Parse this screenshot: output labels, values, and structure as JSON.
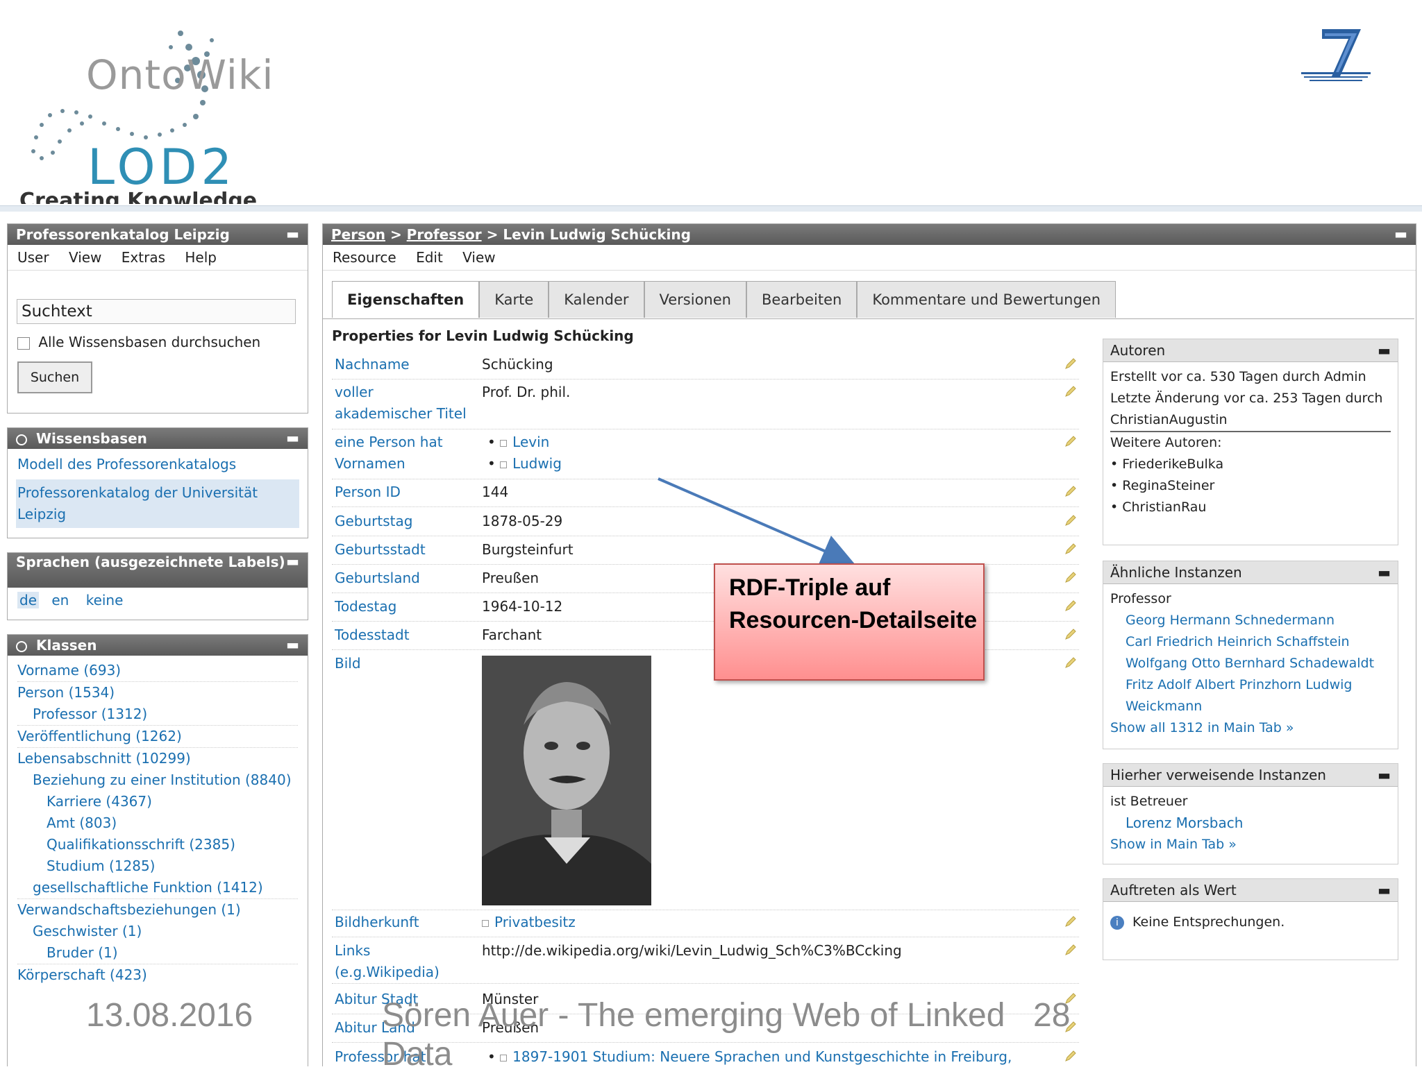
{
  "slide": {
    "logo_ontowiki": "OntoWiki",
    "logo_lod2": "LOD2",
    "tagline": "Creating Knowledge",
    "date": "13.08.2016",
    "title": "Sören Auer - The emerging Web of Linked Data",
    "page": "28"
  },
  "left": {
    "app_box": {
      "title": "Professorenkatalog Leipzig",
      "menu": [
        "User",
        "View",
        "Extras",
        "Help"
      ],
      "search_value": "Suchtext",
      "checkbox_label": "Alle Wissensbasen durchsuchen",
      "search_button": "Suchen"
    },
    "wissensbasen": {
      "title": "Wissensbasen",
      "items": [
        "Modell des Professorenkatalogs",
        "Professorenkatalog der Universität Leipzig"
      ]
    },
    "sprachen": {
      "title": "Sprachen (ausgezeichnete Labels)",
      "items": [
        "de",
        "en",
        "keine"
      ]
    },
    "klassen": {
      "title": "Klassen",
      "items": [
        {
          "label": "Vorname (693)",
          "level": 0
        },
        {
          "label": "Person (1534)",
          "level": 0
        },
        {
          "label": "Professor (1312)",
          "level": 1
        },
        {
          "label": "Veröffentlichung (1262)",
          "level": 0
        },
        {
          "label": "Lebensabschnitt (10299)",
          "level": 0
        },
        {
          "label": "Beziehung zu einer Institution (8840)",
          "level": 1
        },
        {
          "label": "Karriere (4367)",
          "level": 2
        },
        {
          "label": "Amt (803)",
          "level": 2
        },
        {
          "label": "Qualifikationsschrift (2385)",
          "level": 2
        },
        {
          "label": "Studium (1285)",
          "level": 2
        },
        {
          "label": "gesellschaftliche Funktion (1412)",
          "level": 1
        },
        {
          "label": "Verwandschaftsbeziehungen (1)",
          "level": 0
        },
        {
          "label": "Geschwister (1)",
          "level": 1
        },
        {
          "label": "Bruder (1)",
          "level": 2
        },
        {
          "label": "Körperschaft (423)",
          "level": 0
        }
      ]
    }
  },
  "main": {
    "breadcrumb": {
      "part1": "Person",
      "sep": ">",
      "part2": "Professor",
      "current": "Levin Ludwig Schücking"
    },
    "menu": [
      "Resource",
      "Edit",
      "View"
    ],
    "tabs": [
      "Eigenschaften",
      "Karte",
      "Kalender",
      "Versionen",
      "Bearbeiten",
      "Kommentare und Bewertungen"
    ],
    "properties_title": "Properties for Levin Ludwig Schücking",
    "props": {
      "nachname": {
        "name": "Nachname",
        "value": "Schücking"
      },
      "titel": {
        "name": "voller akademischer Titel",
        "value": "Prof. Dr. phil."
      },
      "vornamen": {
        "name": "eine Person hat Vornamen",
        "v1": "Levin",
        "v2": "Ludwig"
      },
      "pid": {
        "name": "Person ID",
        "value": "144"
      },
      "geburtstag": {
        "name": "Geburtstag",
        "value": "1878-05-29"
      },
      "geburtsstadt": {
        "name": "Geburtsstadt",
        "value": "Burgsteinfurt"
      },
      "geburtsland": {
        "name": "Geburtsland",
        "value": "Preußen"
      },
      "todestag": {
        "name": "Todestag",
        "value": "1964-10-12"
      },
      "todesstadt": {
        "name": "Todesstadt",
        "value": "Farchant"
      },
      "bild": {
        "name": "Bild"
      },
      "bildherkunft": {
        "name": "Bildherkunft",
        "value": "Privatbesitz"
      },
      "links": {
        "name": "Links (e.g.Wikipedia)",
        "value": "http://de.wikipedia.org/wiki/Levin_Ludwig_Sch%C3%BCcking"
      },
      "abiturstadt": {
        "name": "Abitur Stadt",
        "value": "Münster"
      },
      "abiturland": {
        "name": "Abitur Land",
        "value": "Preußen"
      },
      "profstudium": {
        "name": "Professor hat",
        "value": "1897-1901 Studium: Neuere Sprachen und Kunstgeschichte in Freiburg,"
      }
    },
    "callout": "RDF-Triple auf Resourcen-Detailseite"
  },
  "right": {
    "autoren": {
      "title": "Autoren",
      "created": "Erstellt vor ca. 530 Tagen durch Admin",
      "changed": "Letzte Änderung vor ca. 253 Tagen durch ChristianAugustin",
      "more_label": "Weitere Autoren:",
      "authors": [
        "FriederikeBulka",
        "ReginaSteiner",
        "ChristianRau"
      ]
    },
    "aehnliche": {
      "title": "Ähnliche Instanzen",
      "class": "Professor",
      "items": [
        "Georg Hermann Schnedermann",
        "Carl Friedrich Heinrich Schaffstein",
        "Wolfgang Otto Bernhard Schadewaldt",
        "Fritz Adolf Albert Prinzhorn",
        "Ludwig Weickmann"
      ],
      "show_all": "Show all 1312 in Main Tab »"
    },
    "verweisende": {
      "title": "Hierher verweisende Instanzen",
      "relation": "ist Betreuer",
      "item": "Lorenz Morsbach",
      "show": "Show in Main Tab »"
    },
    "auftreten": {
      "title": "Auftreten als Wert",
      "text": "Keine Entsprechungen."
    }
  }
}
